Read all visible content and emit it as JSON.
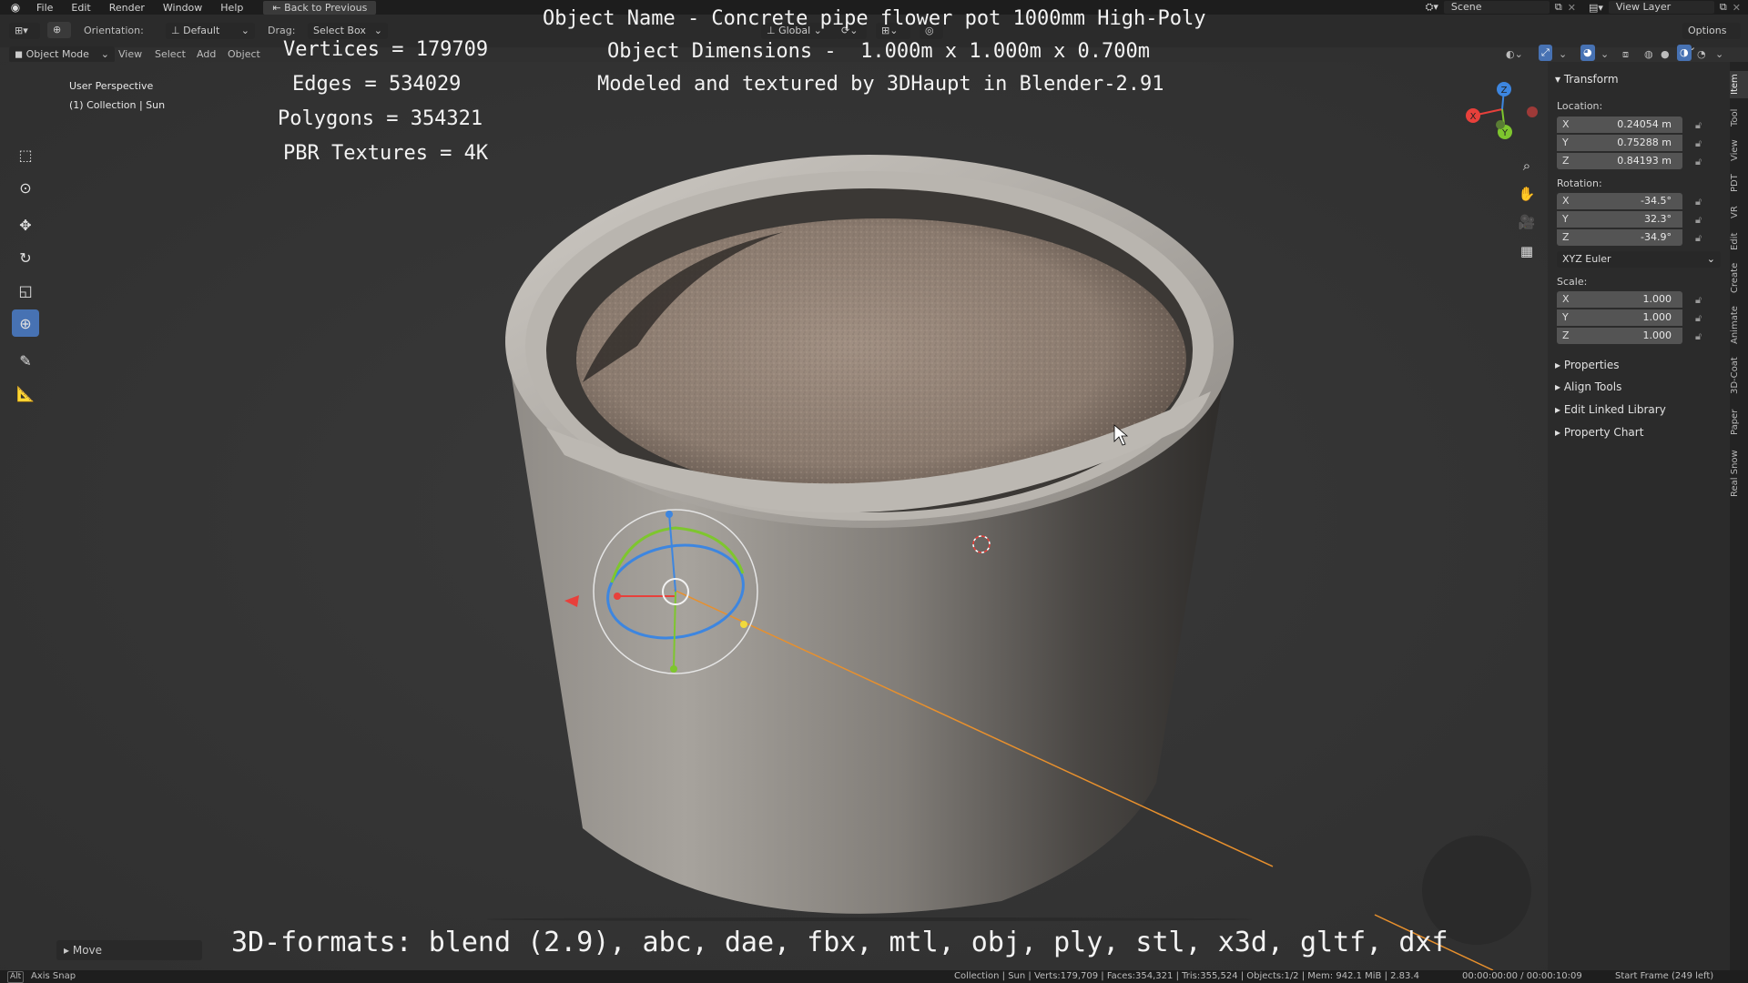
{
  "topbar": {
    "menus": [
      "File",
      "Edit",
      "Render",
      "Window",
      "Help"
    ],
    "back_label": "Back to Previous",
    "scene_label": "Scene",
    "view_layer_label": "View Layer"
  },
  "header": {
    "orientation_label": "Orientation:",
    "orientation_value": "Default",
    "drag_label": "Drag:",
    "drag_value": "Select Box",
    "transform_space": "Global",
    "options_label": "Options",
    "mode": "Object Mode",
    "menus": [
      "View",
      "Select",
      "Add",
      "Object"
    ]
  },
  "viewport": {
    "perspective": "User Perspective",
    "collection": "(1) Collection | Sun",
    "stats": {
      "vertices": "Vertices = 179709",
      "edges": "Edges = 534029",
      "polygons": "Polygons = 354321",
      "textures": "PBR Textures = 4K"
    },
    "info": {
      "name": "Object Name - Concrete pipe flower pot 1000mm High-Poly",
      "dimensions": "Object Dimensions -  1.000m x 1.000m x 0.700m",
      "author": "Modeled and textured by 3DHaupt in Blender-2.91"
    },
    "formats": "3D-formats: blend (2.9), abc, dae, fbx, mtl, obj, ply, stl, x3d, gltf, dxf",
    "gizmo_axes": [
      "X",
      "Y",
      "Z"
    ]
  },
  "npanel": {
    "transform_title": "Transform",
    "location_label": "Location:",
    "location": [
      {
        "axis": "X",
        "value": "0.24054 m"
      },
      {
        "axis": "Y",
        "value": "0.75288 m"
      },
      {
        "axis": "Z",
        "value": "0.84193 m"
      }
    ],
    "rotation_label": "Rotation:",
    "rotation": [
      {
        "axis": "X",
        "value": "-34.5°"
      },
      {
        "axis": "Y",
        "value": "32.3°"
      },
      {
        "axis": "Z",
        "value": "-34.9°"
      }
    ],
    "rotation_mode": "XYZ Euler",
    "scale_label": "Scale:",
    "scale": [
      {
        "axis": "X",
        "value": "1.000"
      },
      {
        "axis": "Y",
        "value": "1.000"
      },
      {
        "axis": "Z",
        "value": "1.000"
      }
    ],
    "subpanels": [
      "Properties",
      "Align Tools",
      "Edit Linked Library",
      "Property Chart"
    ],
    "tabs": [
      "Item",
      "Tool",
      "View",
      "PDT",
      "VR",
      "Edit",
      "Create",
      "Animate",
      "3D-Coat",
      "Paper",
      "Real Snow"
    ]
  },
  "last_operator": "Move",
  "statusbar": {
    "key_hint": "Alt",
    "axis_snap": "Axis Snap",
    "stats": "Collection | Sun | Verts:179,709 | Faces:354,321 | Tris:355,524 | Objects:1/2 | Mem: 942.1 MiB | 2.83.4",
    "timecode": "00:00:00:00 / 00:00:10:09",
    "frame": "Start Frame (249 left)"
  },
  "colors": {
    "accent": "#4772b3",
    "axis_x": "#e8403b",
    "axis_y": "#7ec62e",
    "axis_z": "#3d86e0",
    "light_line": "#e8902d"
  }
}
